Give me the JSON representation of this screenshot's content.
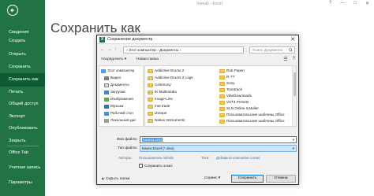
{
  "window": {
    "title": "Книга1 - Excel",
    "controls": [
      "?",
      "—",
      "□",
      "✕"
    ]
  },
  "page_title": "Сохранить как",
  "backstage": {
    "items": [
      {
        "label": "Сведения",
        "active": false
      },
      {
        "label": "Создать",
        "active": false
      },
      {
        "label": "Открыть",
        "active": false
      },
      {
        "label": "Сохранить",
        "active": false
      },
      {
        "label": "Сохранить как",
        "active": true
      },
      {
        "label": "Печать",
        "active": false
      },
      {
        "label": "Общий доступ",
        "active": false
      },
      {
        "label": "Экспорт",
        "active": false
      },
      {
        "label": "Опубликовать",
        "active": false
      },
      {
        "label": "Закрыть",
        "active": false
      },
      {
        "label": "Office Tab",
        "active": false
      },
      {
        "label": "Учетная запись",
        "active": false
      },
      {
        "label": "Параметры",
        "active": false
      }
    ]
  },
  "dialog": {
    "title": "Сохранение документа",
    "address": "› Этот компьютер › Документы ›",
    "search_placeholder": "Поиск: Документы",
    "toolbar": {
      "organize": "Упорядочить ▾",
      "new_folder": "Новая папка"
    },
    "nav_items": [
      "Этот компьютер",
      "Видео",
      "Документы",
      "Загрузки",
      "Изображения",
      "Музыка",
      "Рабочий стол",
      "Локальный дис"
    ],
    "files_col1": [
      "Addictive Drums 2",
      "Addictive Drums 2 Logs",
      "Celemony",
      "IK Multimedia",
      "Image-Line",
      "Inet trade",
      "iZotope",
      "Native Instruments"
    ],
    "files_col2": [
      "Rob Papen",
      "R-TT",
      "Sony",
      "Toontrack",
      "VibeDownloads",
      "VST3 Presets",
      "XLN Online Installer",
      "Пользовательские шаблоны Office",
      "Пользовательские шаблоны Office"
    ],
    "file_name_label": "Имя файла:",
    "file_name_value": "Книга1.xlsx",
    "file_type_label": "Тип файла:",
    "file_type_value": "Книга Excel (*.xlsx)",
    "authors_label": "Авторы:",
    "authors_value": "Пользователь Windo",
    "tags_label": "Теги:",
    "tags_value": "Добавьте ключевое слово",
    "thumbnail_label": "Сохранить эскиз",
    "hide_folders": "▲ Скрыть папки",
    "service": "Сервис ▾",
    "save": "Сохранить",
    "cancel": "Отмена"
  },
  "colors": {
    "backstage_green": "#217346",
    "backstage_active": "#0f5a33",
    "folder_yellow": "#f3c752",
    "selection_blue": "#3399ff"
  }
}
